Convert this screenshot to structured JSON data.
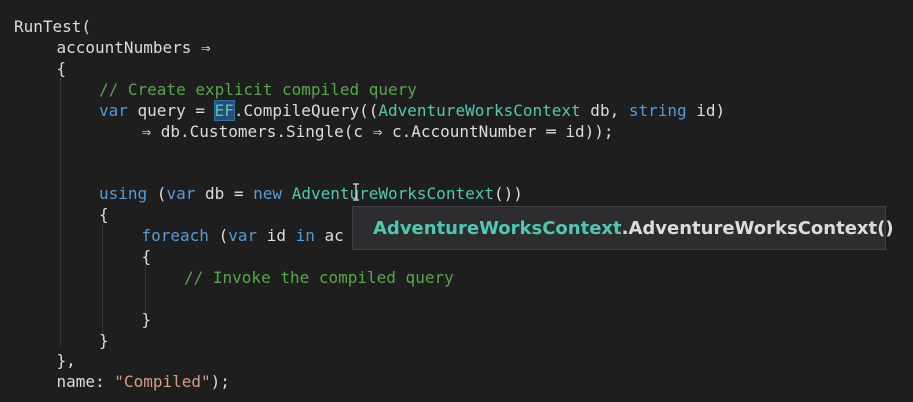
{
  "code_lines": [
    {
      "indent": 0,
      "tokens": [
        {
          "t": "RunTest(",
          "c": "plain"
        }
      ]
    },
    {
      "indent": 1,
      "tokens": [
        {
          "t": "accountNumbers ⇒",
          "c": "plain"
        }
      ]
    },
    {
      "indent": 1,
      "tokens": [
        {
          "t": "{",
          "c": "plain"
        }
      ]
    },
    {
      "indent": 2,
      "tokens": [
        {
          "t": "// Create explicit compiled query",
          "c": "comment"
        }
      ]
    },
    {
      "indent": 2,
      "tokens": [
        {
          "t": "var",
          "c": "kw"
        },
        {
          "t": " query = ",
          "c": "plain"
        },
        {
          "t": "EF",
          "c": "hl"
        },
        {
          "t": ".CompileQuery((",
          "c": "plain"
        },
        {
          "t": "AdventureWorksContext",
          "c": "type"
        },
        {
          "t": " db, ",
          "c": "plain"
        },
        {
          "t": "string",
          "c": "kw"
        },
        {
          "t": " id)",
          "c": "plain"
        }
      ]
    },
    {
      "indent": 3,
      "tokens": [
        {
          "t": "⇒ db.Customers.Single(c ⇒ c.AccountNumber ═ id));",
          "c": "plain"
        }
      ]
    },
    {
      "indent": 2,
      "tokens": []
    },
    {
      "indent": 2,
      "tokens": []
    },
    {
      "indent": 2,
      "tokens": [
        {
          "t": "using",
          "c": "kw"
        },
        {
          "t": " (",
          "c": "plain"
        },
        {
          "t": "var",
          "c": "kw"
        },
        {
          "t": " db = ",
          "c": "plain"
        },
        {
          "t": "new",
          "c": "kw"
        },
        {
          "t": " ",
          "c": "plain"
        },
        {
          "t": "AdventureWorksContext",
          "c": "type"
        },
        {
          "t": "())",
          "c": "plain"
        }
      ]
    },
    {
      "indent": 2,
      "tokens": [
        {
          "t": "{",
          "c": "plain"
        }
      ]
    },
    {
      "indent": 3,
      "tokens": [
        {
          "t": "foreach",
          "c": "kw"
        },
        {
          "t": " (",
          "c": "plain"
        },
        {
          "t": "var",
          "c": "kw"
        },
        {
          "t": " id ",
          "c": "plain"
        },
        {
          "t": "in",
          "c": "kw"
        },
        {
          "t": " ac",
          "c": "plain"
        }
      ]
    },
    {
      "indent": 3,
      "tokens": [
        {
          "t": "{",
          "c": "plain"
        }
      ]
    },
    {
      "indent": 4,
      "tokens": [
        {
          "t": "// Invoke the compiled query",
          "c": "comment"
        }
      ]
    },
    {
      "indent": 4,
      "tokens": []
    },
    {
      "indent": 3,
      "tokens": [
        {
          "t": "}",
          "c": "plain"
        }
      ]
    },
    {
      "indent": 2,
      "tokens": [
        {
          "t": "}",
          "c": "plain"
        }
      ]
    },
    {
      "indent": 1,
      "tokens": [
        {
          "t": "},",
          "c": "plain"
        }
      ]
    },
    {
      "indent": 1,
      "tokens": [
        {
          "t": "name: ",
          "c": "plain"
        },
        {
          "t": "\"Compiled\"",
          "c": "string"
        },
        {
          "t": ");",
          "c": "plain"
        }
      ]
    }
  ],
  "tooltip": {
    "icon": "constructor-method-icon",
    "type_name": "AdventureWorksContext",
    "separator": ".",
    "member": "AdventureWorksContext()"
  },
  "colors": {
    "background": "#1e1e1e",
    "plain": "#dcdcdc",
    "keyword": "#569cd6",
    "type": "#4ec9b0",
    "comment": "#57a64a",
    "string": "#d69d85",
    "highlight": "#264f78",
    "tooltip_bg": "#2d2d30",
    "icon_purple": "#b180d7"
  }
}
